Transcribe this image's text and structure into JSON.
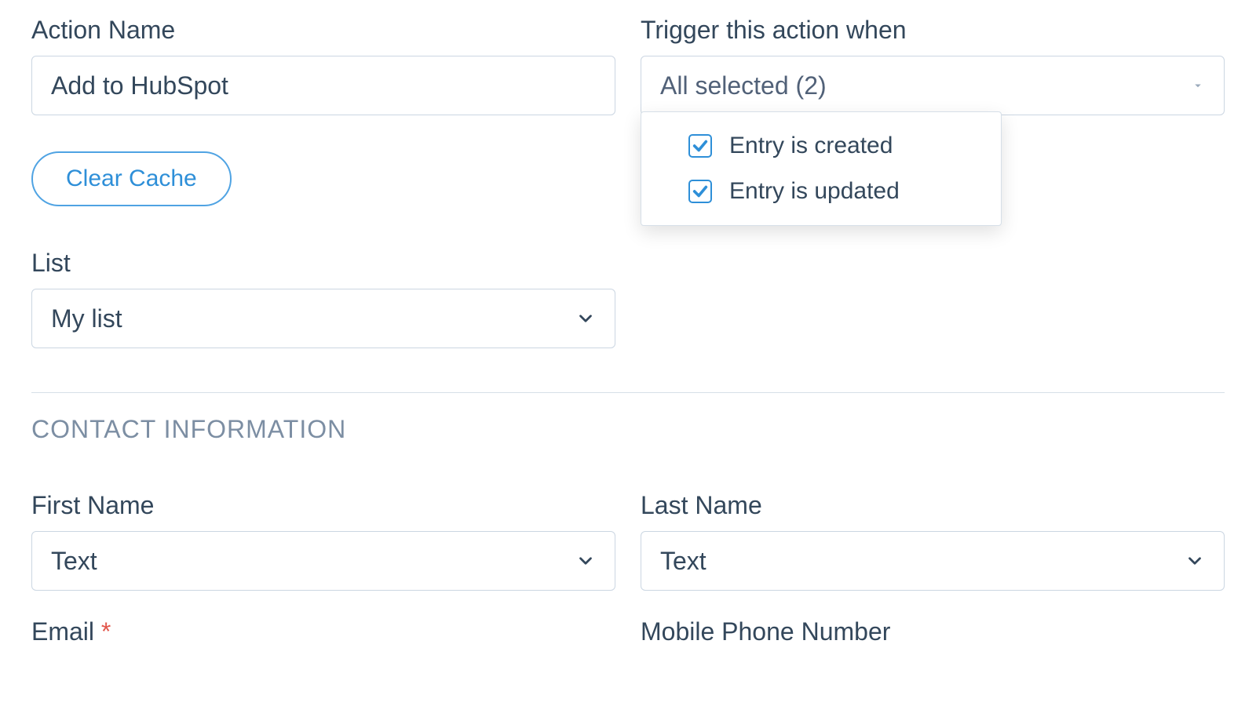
{
  "form": {
    "action_name_label": "Action Name",
    "action_name_value": "Add to HubSpot",
    "trigger_label": "Trigger this action when",
    "trigger_summary": "All selected (2)",
    "trigger_options": [
      {
        "label": "Entry is created",
        "checked": true
      },
      {
        "label": "Entry is updated",
        "checked": true
      }
    ],
    "clear_cache_label": "Clear Cache",
    "list_label": "List",
    "list_value": "My list"
  },
  "section": {
    "heading": "CONTACT INFORMATION",
    "first_name_label": "First Name",
    "first_name_value": "Text",
    "last_name_label": "Last Name",
    "last_name_value": "Text",
    "email_label": "Email",
    "email_required_mark": "*",
    "mobile_label": "Mobile Phone Number"
  }
}
